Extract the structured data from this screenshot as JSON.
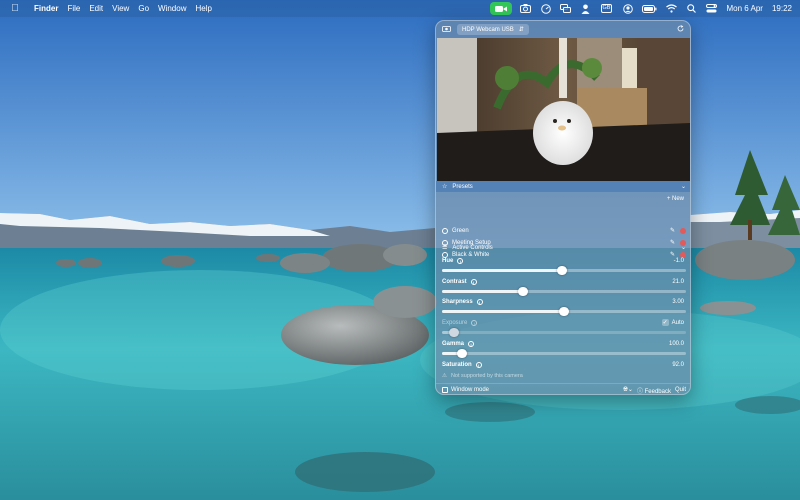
{
  "menubar": {
    "apple_icon": "apple-icon",
    "app_name": "Finder",
    "menus": [
      "File",
      "Edit",
      "View",
      "Go",
      "Window",
      "Help"
    ],
    "status_icons": [
      "camera-icon",
      "screenshot-icon",
      "speed-icon",
      "screens-icon",
      "person-icon",
      "keyboard-input-icon",
      "user-icon",
      "battery-icon",
      "wifi-icon",
      "search-icon",
      "control-center-icon"
    ],
    "input_source": "GB",
    "date": "Mon 6 Apr",
    "time": "19:22",
    "camera_pill_color": "#33c759"
  },
  "panel": {
    "camera_name": "HDP Webcam USB",
    "presets": {
      "title": "Presets",
      "new_label": "+ New",
      "items": [
        {
          "name": "Green"
        },
        {
          "name": "Meeting Setup"
        },
        {
          "name": "Black & White"
        }
      ]
    },
    "active_controls_title": "Active Controls",
    "controls": {
      "hue": {
        "label": "Hue",
        "value": "-1.0",
        "level": 0.49
      },
      "contrast": {
        "label": "Contrast",
        "value": "21.0",
        "level": 0.33
      },
      "sharpness": {
        "label": "Sharpness",
        "value": "3.00",
        "level": 0.5
      },
      "exposure": {
        "label": "Exposure",
        "auto_label": "Auto",
        "auto_checked": true,
        "level": 0.05
      },
      "gamma": {
        "label": "Gamma",
        "value": "100.0",
        "level": 0.08
      },
      "saturation": {
        "label": "Saturation",
        "value": "92.0",
        "notice": "Not supported by this camera"
      }
    },
    "footer": {
      "window_mode": "Window mode",
      "feedback": "Feedback",
      "quit": "Quit"
    }
  }
}
